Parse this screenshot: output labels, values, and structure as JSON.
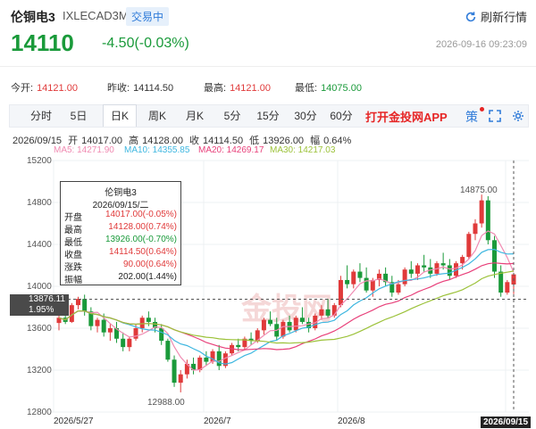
{
  "header": {
    "name": "伦铜电3",
    "code": "IXLECAD3M",
    "status_badge": "交易中",
    "refresh_label": "刷新行情",
    "price": "14110",
    "change": "-4.50(-0.03%)",
    "datetime": "2026-09-16 09:23:09"
  },
  "stats": {
    "open_label": "今开:",
    "open": "14121.00",
    "prev_close_label": "昨收:",
    "prev_close": "14114.50",
    "high_label": "最高:",
    "high": "14121.00",
    "low_label": "最低:",
    "low": "14075.00"
  },
  "tabs": [
    "分时",
    "5日",
    "日K",
    "周K",
    "月K",
    "5分",
    "15分",
    "30分",
    "60分"
  ],
  "active_tab": "日K",
  "app_ad": "打开金投网APP",
  "toolbar_icon_label": "策",
  "ohlc": {
    "date": "2026/09/15",
    "open_label": "开",
    "open": "14017.00",
    "high_label": "高",
    "high": "14128.00",
    "close_label": "收",
    "close": "14114.50",
    "low_label": "低",
    "low": "13926.00",
    "amp_label": "幅",
    "amp": "0.64%"
  },
  "ma_legend": [
    {
      "label": "MA5: 14271.90",
      "color": "#f08bb2"
    },
    {
      "label": "MA10: 14355.85",
      "color": "#3fb7e0"
    },
    {
      "label": "MA20: 14269.17",
      "color": "#e8407a"
    },
    {
      "label": "MA30: 14217.03",
      "color": "#9cc23a"
    }
  ],
  "tooltip": {
    "title": "伦铜电3",
    "date": "2026/09/15/二",
    "rows": [
      {
        "k": "开盘",
        "v": "14017.00(-0.05%)"
      },
      {
        "k": "最高",
        "v": "14128.00(0.74%)"
      },
      {
        "k": "最低",
        "v": "13926.00(-0.70%)"
      },
      {
        "k": "收盘",
        "v": "14114.50(0.64%)"
      },
      {
        "k": "涨跌",
        "v": "90.00(0.64%)"
      },
      {
        "k": "振幅",
        "v": "202.00(1.44%)"
      }
    ]
  },
  "cursor_label": {
    "price": "13876.11",
    "pct": "1.95%"
  },
  "annotations": {
    "high": "14875.00",
    "low": "12988.00"
  },
  "chart_data": {
    "type": "candlestick",
    "y_ticks": [
      15200,
      14800,
      14400,
      14000,
      13600,
      13200,
      12800
    ],
    "ylim": [
      12800,
      15200
    ],
    "x_ticks": [
      "2026/5/27",
      "2026/7",
      "2026/8",
      "2026/09/15"
    ],
    "candles": [
      [
        13650,
        13720,
        13580,
        13700
      ],
      [
        13700,
        13760,
        13640,
        13660
      ],
      [
        13660,
        13840,
        13650,
        13820
      ],
      [
        13820,
        13900,
        13780,
        13880
      ],
      [
        13880,
        13920,
        13720,
        13760
      ],
      [
        13760,
        13800,
        13580,
        13620
      ],
      [
        13620,
        13700,
        13560,
        13680
      ],
      [
        13680,
        13740,
        13520,
        13560
      ],
      [
        13560,
        13640,
        13480,
        13600
      ],
      [
        13600,
        13660,
        13460,
        13500
      ],
      [
        13500,
        13560,
        13380,
        13420
      ],
      [
        13420,
        13520,
        13380,
        13500
      ],
      [
        13500,
        13640,
        13480,
        13600
      ],
      [
        13600,
        13720,
        13560,
        13700
      ],
      [
        13700,
        13760,
        13620,
        13660
      ],
      [
        13660,
        13700,
        13560,
        13600
      ],
      [
        13600,
        13640,
        13440,
        13480
      ],
      [
        13480,
        13500,
        13280,
        13300
      ],
      [
        13300,
        13340,
        13040,
        13080
      ],
      [
        13080,
        13200,
        12988,
        13160
      ],
      [
        13160,
        13300,
        13120,
        13260
      ],
      [
        13260,
        13320,
        13160,
        13200
      ],
      [
        13200,
        13340,
        13180,
        13320
      ],
      [
        13320,
        13380,
        13240,
        13280
      ],
      [
        13280,
        13400,
        13260,
        13380
      ],
      [
        13380,
        13440,
        13200,
        13240
      ],
      [
        13240,
        13380,
        13220,
        13360
      ],
      [
        13360,
        13460,
        13340,
        13440
      ],
      [
        13440,
        13500,
        13380,
        13420
      ],
      [
        13420,
        13520,
        13400,
        13500
      ],
      [
        13500,
        13560,
        13440,
        13480
      ],
      [
        13480,
        13600,
        13460,
        13580
      ],
      [
        13580,
        13700,
        13540,
        13680
      ],
      [
        13680,
        13760,
        13620,
        13640
      ],
      [
        13640,
        13700,
        13480,
        13520
      ],
      [
        13520,
        13680,
        13500,
        13660
      ],
      [
        13660,
        13720,
        13560,
        13580
      ],
      [
        13580,
        13720,
        13560,
        13700
      ],
      [
        13700,
        13800,
        13640,
        13660
      ],
      [
        13660,
        13700,
        13560,
        13600
      ],
      [
        13600,
        13740,
        13580,
        13720
      ],
      [
        13720,
        13820,
        13680,
        13780
      ],
      [
        13780,
        13880,
        13700,
        13720
      ],
      [
        13720,
        13840,
        13700,
        13820
      ],
      [
        13820,
        14100,
        13800,
        14060
      ],
      [
        14060,
        14200,
        13980,
        14020
      ],
      [
        14020,
        14160,
        13980,
        14140
      ],
      [
        14140,
        14220,
        14040,
        14080
      ],
      [
        14080,
        14180,
        13940,
        13960
      ],
      [
        13960,
        14080,
        13900,
        14060
      ],
      [
        14060,
        14160,
        14000,
        14120
      ],
      [
        14120,
        14180,
        14000,
        14040
      ],
      [
        14040,
        14100,
        13900,
        13940
      ],
      [
        13940,
        14060,
        13920,
        14020
      ],
      [
        14020,
        14180,
        14000,
        14160
      ],
      [
        14160,
        14240,
        14080,
        14120
      ],
      [
        14120,
        14220,
        14060,
        14200
      ],
      [
        14200,
        14300,
        14140,
        14180
      ],
      [
        14180,
        14260,
        14080,
        14120
      ],
      [
        14120,
        14240,
        14100,
        14220
      ],
      [
        14220,
        14320,
        14160,
        14200
      ],
      [
        14200,
        14260,
        14060,
        14100
      ],
      [
        14100,
        14240,
        14080,
        14220
      ],
      [
        14220,
        14300,
        14160,
        14280
      ],
      [
        14280,
        14520,
        14260,
        14500
      ],
      [
        14500,
        14640,
        14440,
        14600
      ],
      [
        14600,
        14875,
        14560,
        14820
      ],
      [
        14820,
        14860,
        14400,
        14440
      ],
      [
        14440,
        14480,
        14080,
        14140
      ],
      [
        14140,
        14200,
        13900,
        13940
      ],
      [
        13940,
        14060,
        13920,
        14040
      ],
      [
        14017,
        14128,
        13926,
        14114
      ]
    ]
  },
  "colors": {
    "up": "#e03a3a",
    "down": "#1a9a3a"
  }
}
